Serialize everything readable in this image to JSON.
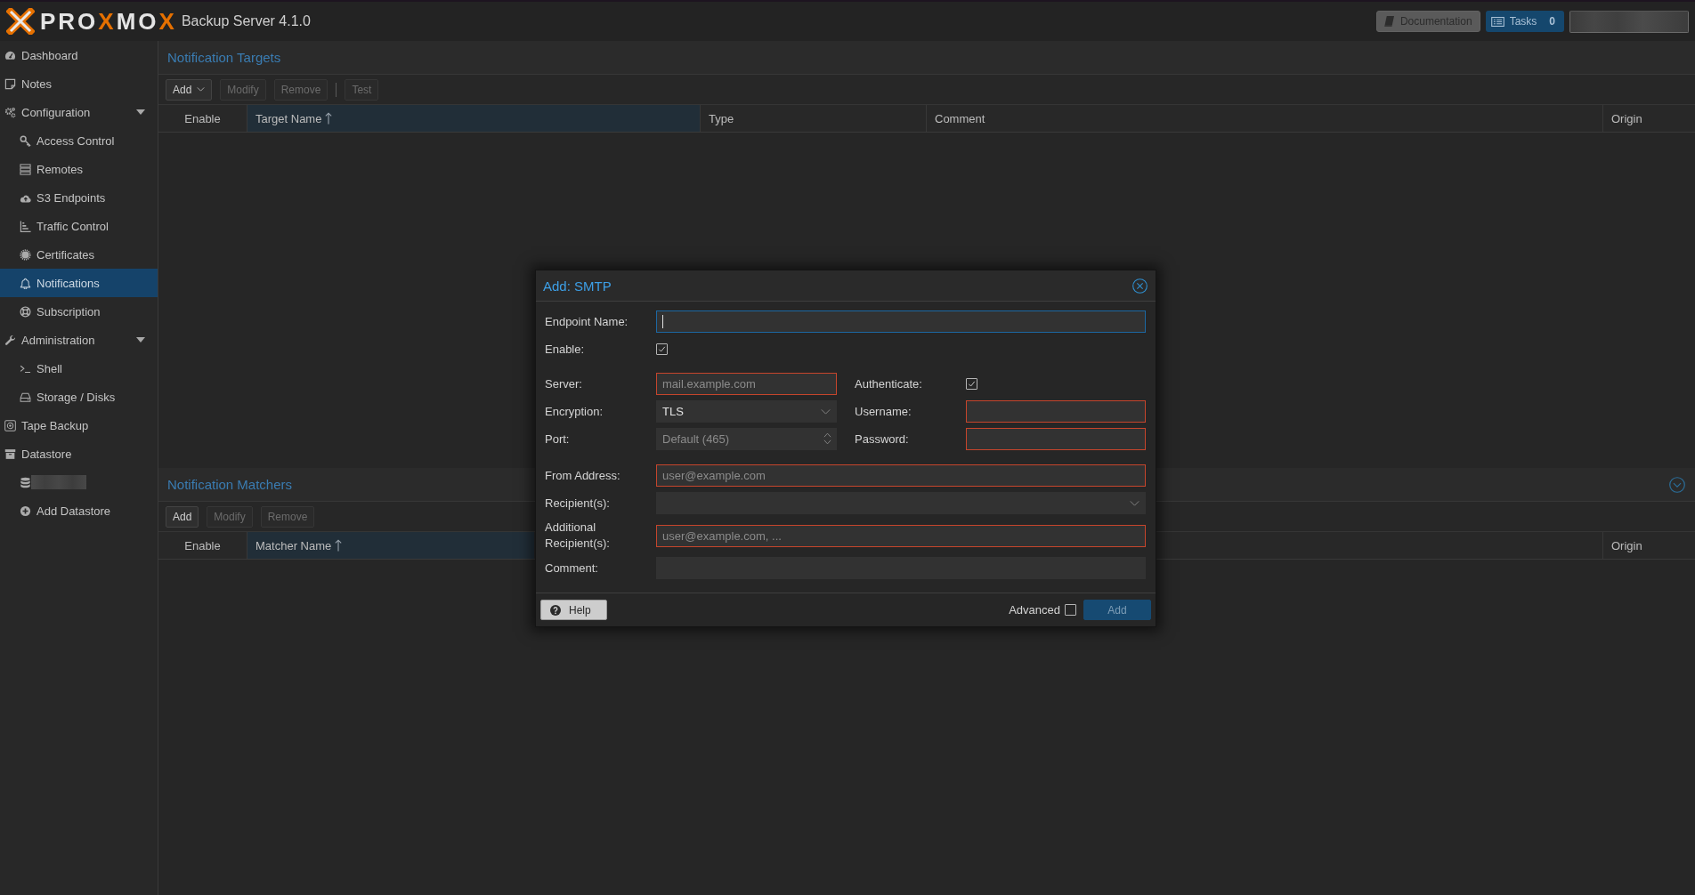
{
  "header": {
    "logo": {
      "parts": [
        {
          "text": "PRO",
          "accent": false
        },
        {
          "text": "X",
          "accent": true
        },
        {
          "text": "MO",
          "accent": false
        },
        {
          "text": "X",
          "accent": true
        }
      ]
    },
    "product": "Backup Server 4.1.0",
    "documentation_button": "Documentation",
    "tasks_button": {
      "label": "Tasks",
      "count": "0"
    }
  },
  "sidebar": {
    "items": [
      {
        "label": "Dashboard",
        "selected": false
      },
      {
        "label": "Notes",
        "selected": false
      },
      {
        "label": "Configuration",
        "selected": false,
        "expanded": true,
        "children": [
          {
            "label": "Access Control",
            "selected": false
          },
          {
            "label": "Remotes",
            "selected": false
          },
          {
            "label": "S3 Endpoints",
            "selected": false
          },
          {
            "label": "Traffic Control",
            "selected": false
          },
          {
            "label": "Certificates",
            "selected": false
          },
          {
            "label": "Notifications",
            "selected": true
          },
          {
            "label": "Subscription",
            "selected": false
          }
        ]
      },
      {
        "label": "Administration",
        "selected": false,
        "expanded": true,
        "children": [
          {
            "label": "Shell",
            "selected": false
          },
          {
            "label": "Storage / Disks",
            "selected": false
          }
        ]
      },
      {
        "label": "Tape Backup",
        "selected": false
      },
      {
        "label": "Datastore",
        "selected": false,
        "children": [
          {
            "kind": "redacted",
            "selected": false
          },
          {
            "kind": "link",
            "label": "Add Datastore",
            "selected": false
          }
        ]
      }
    ]
  },
  "targets_panel": {
    "title": "Notification Targets",
    "toolbar": [
      {
        "kind": "menu",
        "label": "Add",
        "disabled": false
      },
      {
        "kind": "button",
        "label": "Modify",
        "disabled": true
      },
      {
        "kind": "button",
        "label": "Remove",
        "disabled": true
      },
      {
        "kind": "separator"
      },
      {
        "kind": "button",
        "label": "Test",
        "disabled": true
      }
    ],
    "columns": [
      {
        "label": "Enable",
        "sorted": false
      },
      {
        "label": "Target Name",
        "sorted": true
      },
      {
        "label": "Type",
        "sorted": false
      },
      {
        "label": "Comment",
        "sorted": false
      },
      {
        "label": "Origin",
        "sorted": false
      }
    ]
  },
  "matchers_panel": {
    "title": "Notification Matchers",
    "collapsed": false,
    "toolbar": [
      {
        "kind": "button",
        "label": "Add",
        "disabled": false
      },
      {
        "kind": "button",
        "label": "Modify",
        "disabled": true
      },
      {
        "kind": "button",
        "label": "Remove",
        "disabled": true
      }
    ],
    "columns": [
      {
        "label": "Enable",
        "sorted": false
      },
      {
        "label": "Matcher Name",
        "sorted": true
      },
      {
        "label": "Origin",
        "sorted": false
      }
    ]
  },
  "dialog": {
    "title": "Add: SMTP",
    "top_fields": [
      {
        "label": "Endpoint Name:",
        "kind": "text",
        "focused": true,
        "invalid": false
      },
      {
        "label": "Enable:",
        "kind": "checkbox",
        "checked": true
      }
    ],
    "left_fields": [
      {
        "label": "Server:",
        "kind": "text",
        "placeholder": "mail.example.com",
        "focused": false,
        "invalid": true
      },
      {
        "label": "Encryption:",
        "kind": "combo",
        "value": "TLS",
        "focused": false,
        "invalid": false
      },
      {
        "label": "Port:",
        "kind": "number",
        "placeholder": "Default (465)",
        "focused": false,
        "invalid": false
      }
    ],
    "right_fields": [
      {
        "label": "Authenticate:",
        "kind": "checkbox",
        "checked": true
      },
      {
        "label": "Username:",
        "kind": "text",
        "focused": false,
        "invalid": true
      },
      {
        "label": "Password:",
        "kind": "password",
        "focused": false,
        "invalid": true
      }
    ],
    "bottom_fields": [
      {
        "label": "From Address:",
        "kind": "text",
        "placeholder": "user@example.com",
        "focused": false,
        "invalid": true
      },
      {
        "label": "Recipient(s):",
        "kind": "combo",
        "focused": false,
        "invalid": false
      },
      {
        "label": "Additional Recipient(s):",
        "kind": "text",
        "placeholder": "user@example.com, ...",
        "focused": false,
        "invalid": true
      },
      {
        "label": "Comment:",
        "kind": "text",
        "focused": false,
        "invalid": false
      }
    ],
    "help_button": "Help",
    "advanced": {
      "label": "Advanced",
      "checked": false
    },
    "submit_button": {
      "label": "Add",
      "disabled": true
    }
  }
}
